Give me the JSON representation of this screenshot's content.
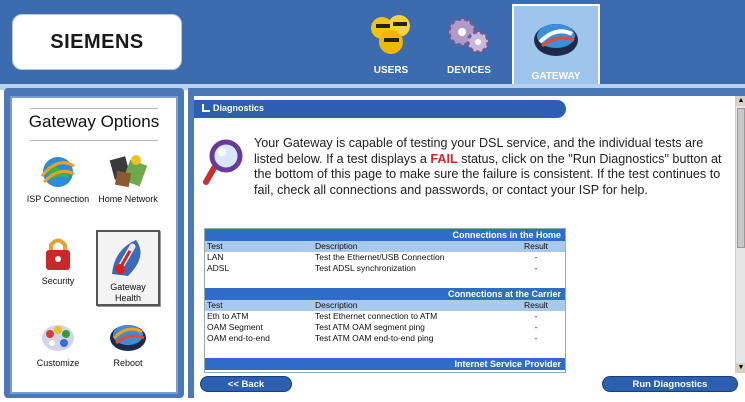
{
  "brand": {
    "logo": "SIEMENS"
  },
  "nav": {
    "tabs": [
      {
        "label": "USERS",
        "icon": "users-icon",
        "active": false
      },
      {
        "label": "DEVICES",
        "icon": "devices-icon",
        "active": false
      },
      {
        "label": "GATEWAY",
        "icon": "gateway-icon",
        "active": true
      }
    ]
  },
  "sidebar": {
    "title": "Gateway Options",
    "items": [
      {
        "label": "ISP Connection",
        "icon": "isp-connection-icon"
      },
      {
        "label": "Home Network",
        "icon": "home-network-icon"
      },
      {
        "label": "Security",
        "icon": "security-icon"
      },
      {
        "label": "Gateway Health",
        "icon": "gateway-health-icon",
        "selected": true
      },
      {
        "label": "Customize",
        "icon": "customize-icon"
      },
      {
        "label": "Reboot",
        "icon": "reboot-icon"
      }
    ]
  },
  "main": {
    "section_title": "Diagnostics",
    "intro_before": "Your Gateway is capable of testing your DSL service, and the individual tests are listed below. If a test displays a ",
    "intro_fail": "FAIL",
    "intro_after": " status, click on the \"Run Diagnostics\" button at the bottom of this page to make sure the failure is consistent. If the test continues to fail, check all connections and passwords, or contact your ISP for help.",
    "columns": {
      "test": "Test",
      "description": "Description",
      "result": "Result"
    },
    "groups": [
      {
        "title": "Connections in the Home",
        "rows": [
          {
            "test": "LAN",
            "description": "Test the Ethernet/USB Connection",
            "result": "-"
          },
          {
            "test": "ADSL",
            "description": "Test ADSL synchronization",
            "result": "-"
          }
        ]
      },
      {
        "title": "Connections at the Carrier",
        "rows": [
          {
            "test": "Eth to ATM",
            "description": "Test Ethernet connection to ATM",
            "result": "-"
          },
          {
            "test": "OAM Segment",
            "description": "Test ATM OAM segment ping",
            "result": "-"
          },
          {
            "test": "OAM end-to-end",
            "description": "Test ATM OAM end-to-end ping",
            "result": "-"
          }
        ]
      },
      {
        "title": "Internet Service Provider",
        "rows": []
      }
    ]
  },
  "buttons": {
    "back": "<< Back",
    "run": "Run Diagnostics"
  },
  "colors": {
    "top_bar": "#3c6bb0",
    "header_blue": "#2c5fb0",
    "fail_red": "#e02020",
    "col_header": "#a9c9ee"
  }
}
